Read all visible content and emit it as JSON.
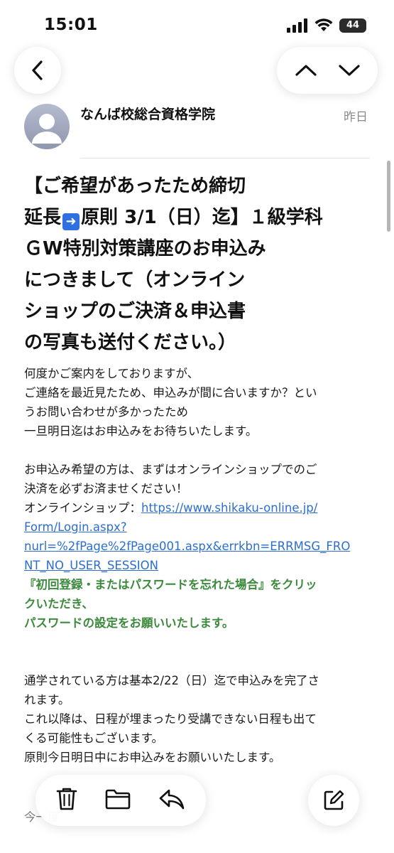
{
  "status": {
    "time": "15:01",
    "battery": "44"
  },
  "email": {
    "sender": "なんば校総合資格学院",
    "date": "昨日",
    "subject_lines": [
      "【ご希望があったため締切",
      "原則 3/1（日）迄】１級学科",
      "ＧW特別対策講座のお申込み",
      "につきまして（オンライン",
      "ショップのご決済＆申込書",
      "の写真も送付ください。）"
    ],
    "subject_prefix": "延長",
    "body": {
      "p1": [
        "何度かご案内をしておりますが、",
        "ご連絡を最近見たため、申込みが間に合いますか？とい",
        "うお問い合わせが多かったため",
        "一旦明日迄はお申込みをお待ちいたします。"
      ],
      "p2": [
        "お申込み希望の方は、まずはオンラインショップでのご",
        "決済を必ずお済ませください！"
      ],
      "shop_label": "オンラインショップ：",
      "link_lines": [
        "https://www.shikaku-online.jp/",
        "Form/Login.aspx?",
        "nurl=%2fPage%2fPage001.aspx&errkbn=ERRMSG_FRO",
        "NT_NO_USER_SESSION"
      ],
      "green_lines": [
        "『初回登録・またはパスワードを忘れた場合』をクリッ",
        "クいただき、",
        "パスワードの設定をお願いいたします。"
      ],
      "p3": [
        "通学されている方は基本2/22（日）迄で申込みを完了さ",
        "れます。",
        "これ以降は、日程が埋まったり受講できない日程も出て",
        "くる可能性もございます。",
        "原則今日明日中にお申込みをお願いいたします。"
      ],
      "peek": "今一度"
    }
  }
}
